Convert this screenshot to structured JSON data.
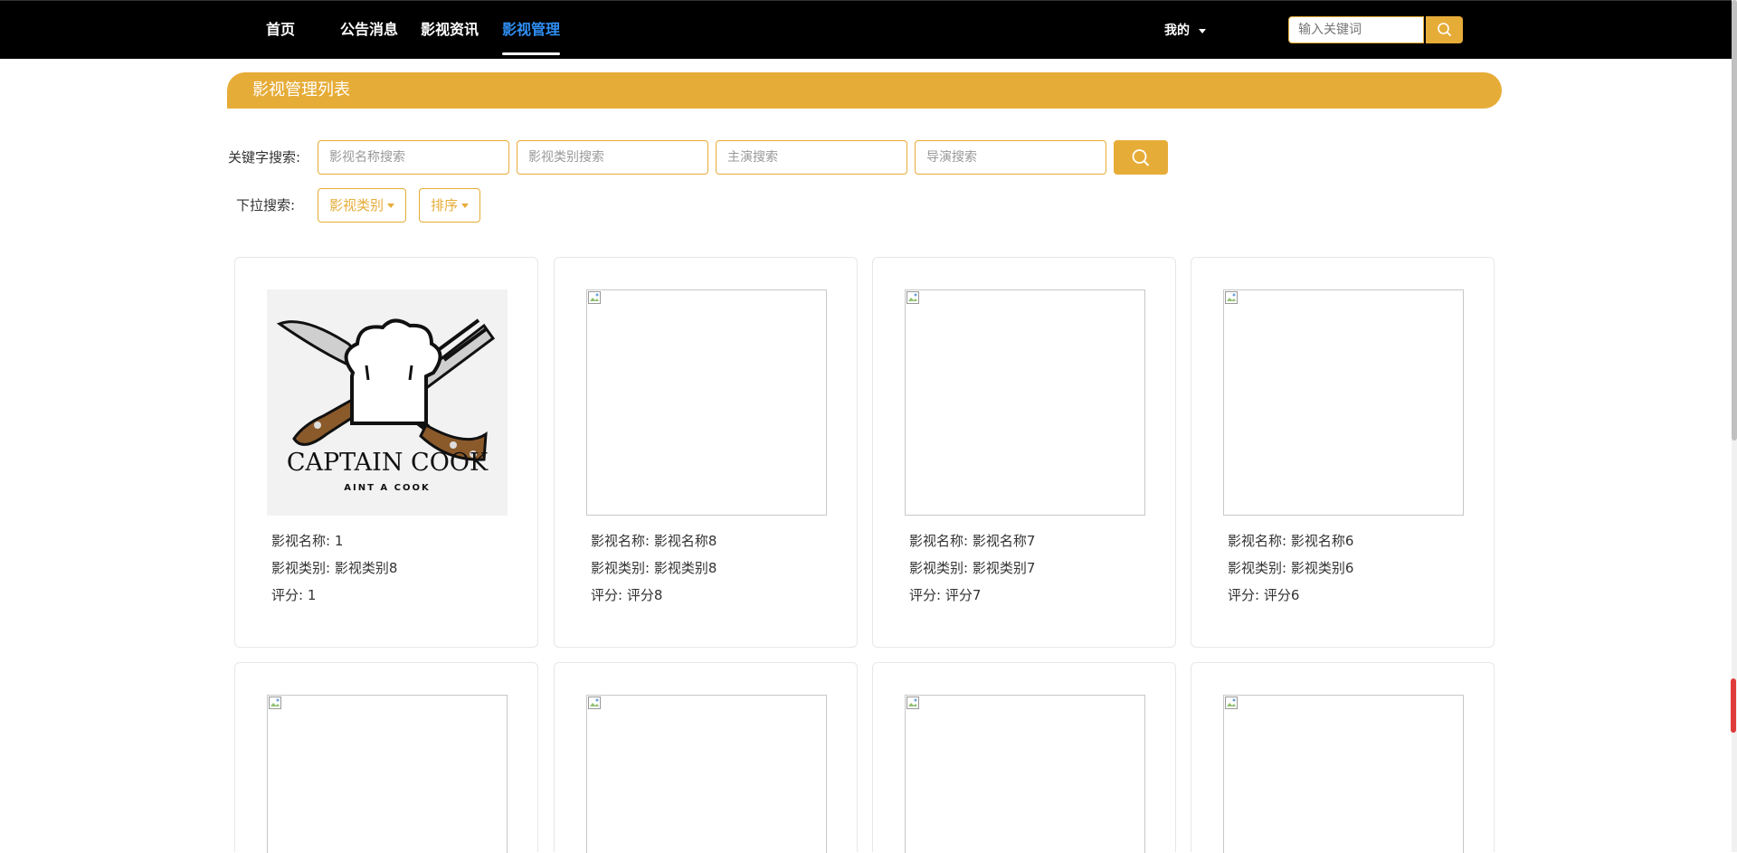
{
  "nav": {
    "items": [
      {
        "label": "首页"
      },
      {
        "label": "公告消息"
      },
      {
        "label": "影视资讯"
      },
      {
        "label": "影视管理"
      }
    ],
    "user_menu": "我的",
    "search_placeholder": "输入关键词"
  },
  "colors": {
    "accent": "#e6ac38",
    "active_nav": "#2f8ff5",
    "topbar": "#000000"
  },
  "section": {
    "title": "影视管理列表"
  },
  "filters": {
    "keyword_label": "关键字搜索:",
    "name_placeholder": "影视名称搜索",
    "type_placeholder": "影视类别搜索",
    "actor_placeholder": "主演搜索",
    "director_placeholder": "导演搜索",
    "dropdown_label": "下拉搜索:",
    "type_dropdown": "影视类别",
    "sort_dropdown": "排序"
  },
  "logo_text": {
    "main": "CAPTAIN COOK",
    "sub": "AINT A COOK"
  },
  "cards": [
    {
      "name_label": "影视名称: 1",
      "type_label": "影视类别: 影视类别8",
      "score_label": "评分: 1"
    },
    {
      "name_label": "影视名称: 影视名称8",
      "type_label": "影视类别: 影视类别8",
      "score_label": "评分: 评分8"
    },
    {
      "name_label": "影视名称: 影视名称7",
      "type_label": "影视类别: 影视类别7",
      "score_label": "评分: 评分7"
    },
    {
      "name_label": "影视名称: 影视名称6",
      "type_label": "影视类别: 影视类别6",
      "score_label": "评分: 评分6"
    }
  ]
}
